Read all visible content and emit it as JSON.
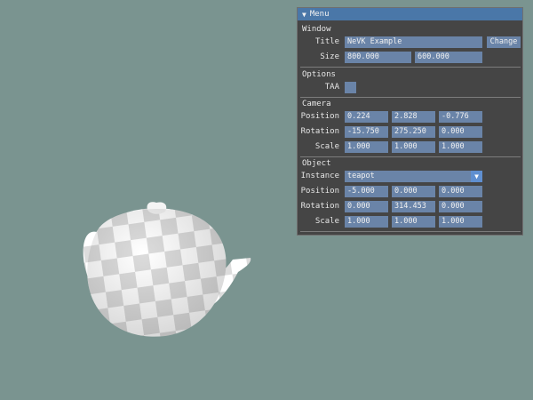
{
  "menu": {
    "title": "Menu",
    "collapse_icon": "triangle-down-icon",
    "window": {
      "heading": "Window",
      "title_label": "Title",
      "title_value": "NeVK Example",
      "change_button": "Change",
      "size_label": "Size",
      "size_values": [
        "800.000",
        "600.000"
      ]
    },
    "options": {
      "heading": "Options",
      "taa_label": "TAA",
      "taa_checked": false
    },
    "camera": {
      "heading": "Camera",
      "position_label": "Position",
      "position": [
        "0.224",
        "2.828",
        "-0.776"
      ],
      "rotation_label": "Rotation",
      "rotation": [
        "-15.750",
        "275.250",
        "0.000"
      ],
      "scale_label": "Scale",
      "scale": [
        "1.000",
        "1.000",
        "1.000"
      ]
    },
    "object": {
      "heading": "Object",
      "instance_label": "Instance",
      "instance_value": "teapot",
      "dropdown_icon": "triangle-down-icon",
      "position_label": "Position",
      "position": [
        "-5.000",
        "0.000",
        "0.000"
      ],
      "rotation_label": "Rotation",
      "rotation": [
        "0.000",
        "314.453",
        "0.000"
      ],
      "scale_label": "Scale",
      "scale": [
        "1.000",
        "1.000",
        "1.000"
      ]
    }
  },
  "scene": {
    "background_color": "#7a9490",
    "object": "teapot",
    "texture": "checkerboard"
  }
}
